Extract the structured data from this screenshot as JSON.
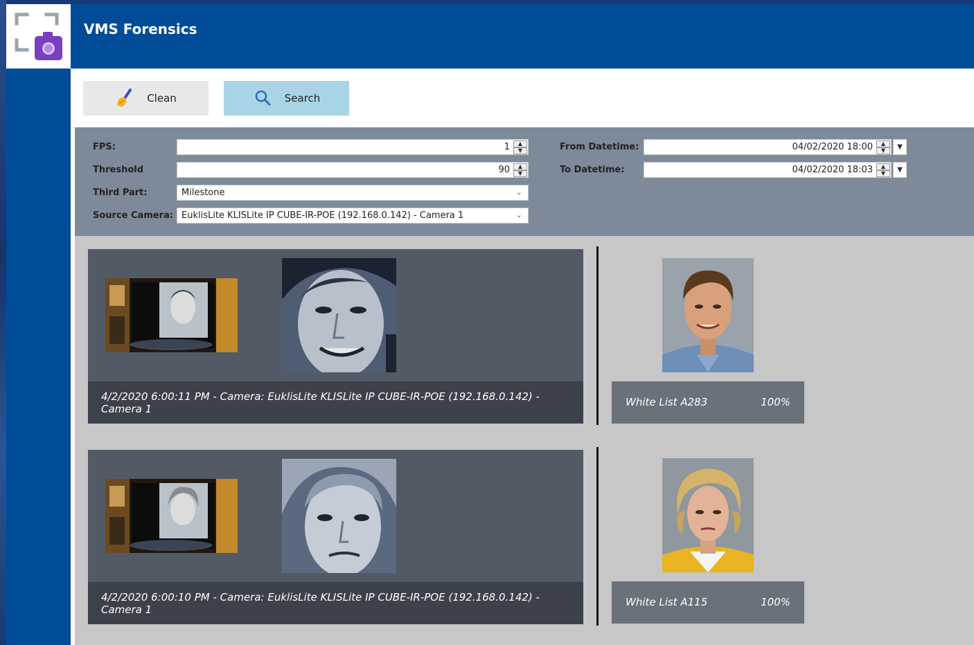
{
  "app": {
    "title": "VMS Forensics",
    "accent_color": "#004c99",
    "logo_icon": "camera-frame-icon"
  },
  "toolbar": {
    "clean_label": "Clean",
    "clean_icon": "broom-icon",
    "search_label": "Search",
    "search_icon": "search-icon"
  },
  "filters": {
    "fps_label": "FPS:",
    "fps_value": "1",
    "threshold_label": "Threshold",
    "threshold_value": "90",
    "third_part_label": "Third Part:",
    "third_part_value": "Milestone",
    "source_camera_label": "Source Camera:",
    "source_camera_value": "EuklisLite KLISLite IP CUBE-IR-POE (192.168.0.142) - Camera 1",
    "from_label": "From Datetime:",
    "from_value": "04/02/2020 18:00",
    "to_label": "To Datetime:",
    "to_value": "04/02/2020 18:03"
  },
  "results": [
    {
      "caption": "4/2/2020 6:00:11 PM - Camera: EuklisLite KLISLite IP CUBE-IR-POE (192.168.0.142) - Camera 1",
      "match_name": "White List A283",
      "match_score": "100%"
    },
    {
      "caption": "4/2/2020 6:00:10 PM - Camera: EuklisLite KLISLite IP CUBE-IR-POE (192.168.0.142) - Camera 1",
      "match_name": "White List A115",
      "match_score": "100%"
    }
  ]
}
